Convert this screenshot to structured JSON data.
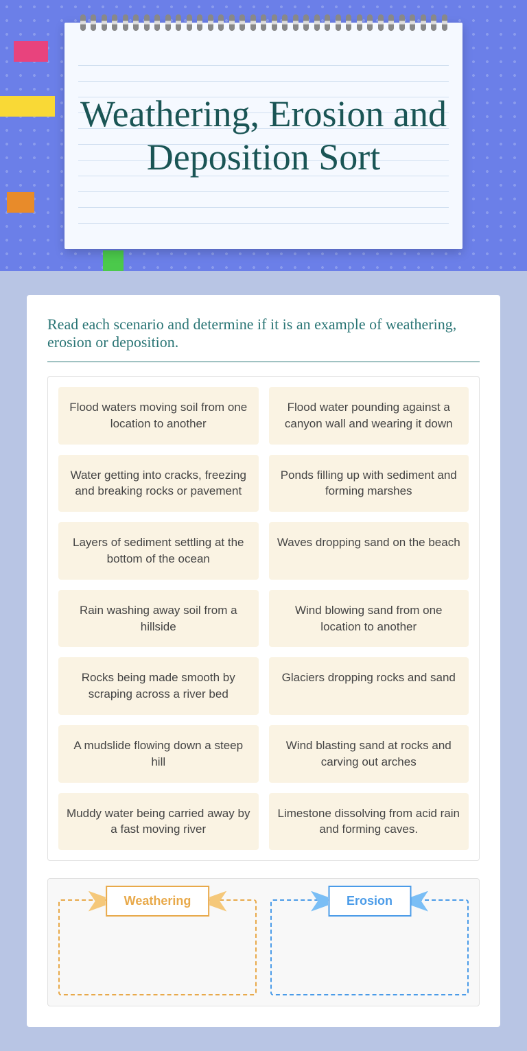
{
  "title": "Weathering, Erosion and Deposition Sort",
  "instructions": "Read each scenario and determine if it is an example of weathering, erosion or deposition.",
  "cards": [
    "Flood waters moving soil from one location to another",
    "Flood water pounding against a canyon wall and wearing it down",
    "Water getting into cracks, freezing and breaking rocks or pavement",
    "Ponds filling up with sediment and forming marshes",
    "Layers of sediment settling at the bottom of the ocean",
    "Waves dropping sand on the beach",
    "Rain washing away soil from a hillside",
    "Wind blowing sand from one location to another",
    "Rocks being made smooth by scraping across a river bed",
    "Glaciers dropping rocks and sand",
    "A mudslide flowing down a steep hill",
    "Wind blasting sand at rocks and carving out arches",
    "Muddy water being carried away by a fast moving river",
    "Limestone dissolving from acid rain and forming caves."
  ],
  "zones": {
    "weathering": "Weathering",
    "erosion": "Erosion"
  }
}
